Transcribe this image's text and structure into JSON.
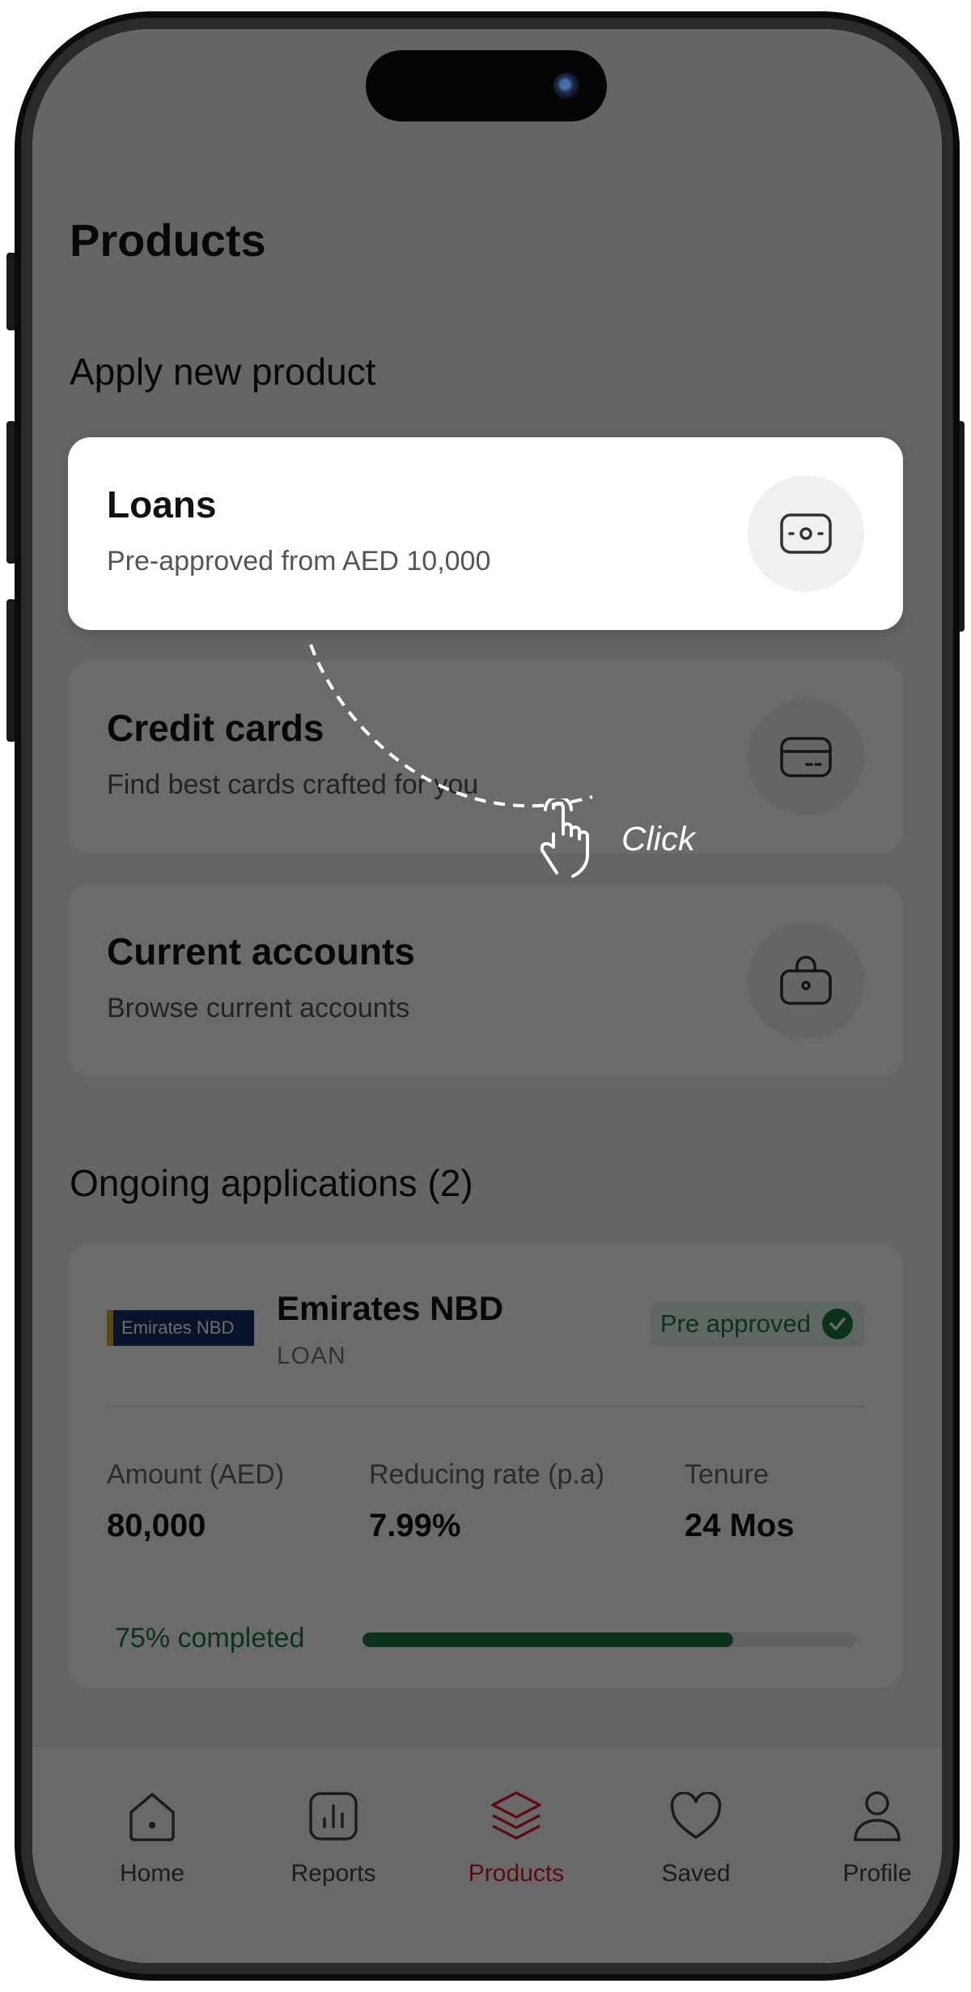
{
  "page": {
    "title": "Products"
  },
  "apply_section": {
    "title": "Apply new product",
    "products": [
      {
        "title": "Loans",
        "subtitle": "Pre-approved from AED 10,000",
        "icon": "wallet-icon"
      },
      {
        "title": "Credit cards",
        "subtitle": "Find best cards crafted for you",
        "icon": "credit-card-icon"
      },
      {
        "title": "Current accounts",
        "subtitle": "Browse current accounts",
        "icon": "bag-icon"
      }
    ]
  },
  "ongoing": {
    "title": "Ongoing applications (2)",
    "application": {
      "logo_text": "Emirates NBD",
      "bank": "Emirates NBD",
      "type": "LOAN",
      "status": "Pre approved",
      "metrics": [
        {
          "label": "Amount (AED)",
          "value": "80,000"
        },
        {
          "label": "Reducing rate (p.a)",
          "value": "7.99%"
        },
        {
          "label": "Tenure",
          "value": "24 Mos"
        }
      ],
      "progress_label": "75% completed",
      "progress_fraction": 0.75
    }
  },
  "gesture": {
    "label": "Click"
  },
  "bottom_nav": [
    {
      "label": "Home",
      "icon": "home-icon"
    },
    {
      "label": "Reports",
      "icon": "reports-icon"
    },
    {
      "label": "Products",
      "icon": "layers-icon",
      "active": true
    },
    {
      "label": "Saved",
      "icon": "heart-icon"
    },
    {
      "label": "Profile",
      "icon": "profile-icon"
    }
  ],
  "colors": {
    "accent": "#e11d2a",
    "success": "#1f7a45",
    "overlay": "#000000"
  }
}
